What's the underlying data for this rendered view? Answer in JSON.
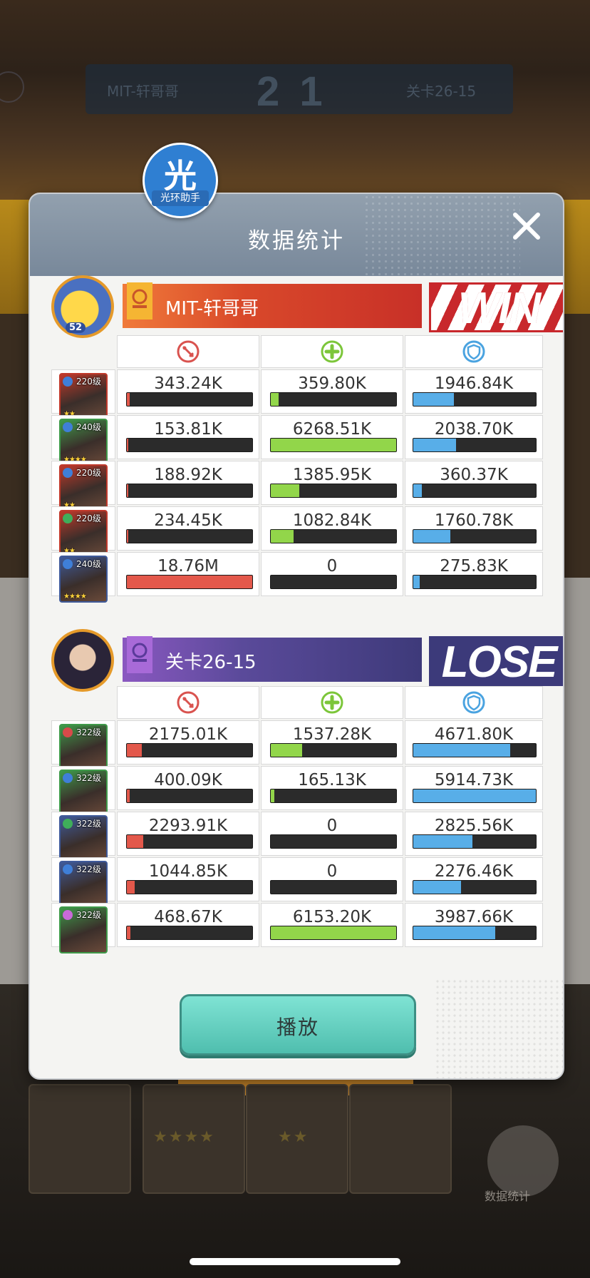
{
  "dialog": {
    "title": "数据统计",
    "helper_badge": {
      "glyph": "光",
      "label": "光环助手"
    },
    "play_button": "播放"
  },
  "background": {
    "score": "2 1",
    "left_name": "MIT-轩哥哥",
    "right_name": "关卡26-15",
    "stats_label": "数据统计"
  },
  "stat_columns": [
    {
      "key": "damage",
      "icon": "damage-icon",
      "color": "#e3584b"
    },
    {
      "key": "healing",
      "icon": "heal-icon",
      "color": "#92d64a"
    },
    {
      "key": "damage_taken",
      "icon": "shield-icon",
      "color": "#58aee8"
    }
  ],
  "teams": [
    {
      "name": "MIT-轩哥哥",
      "result": "WIN",
      "avatar_level": "52",
      "banner_color": "#d9492a",
      "heroes": [
        {
          "level": "220级",
          "gem": "#3f7fd8",
          "stars": "★★",
          "frame": "#c0392b",
          "damage": "343.24K",
          "healing": "359.80K",
          "damage_taken": "1946.84K",
          "damage_pct": 0.02,
          "healing_pct": 0.06,
          "damage_taken_pct": 0.33
        },
        {
          "level": "240级",
          "gem": "#3f7fd8",
          "stars": "★★★★",
          "frame": "#3f9a4a",
          "damage": "153.81K",
          "healing": "6268.51K",
          "damage_taken": "2038.70K",
          "damage_pct": 0.01,
          "healing_pct": 1.0,
          "damage_taken_pct": 0.35
        },
        {
          "level": "220级",
          "gem": "#3f7fd8",
          "stars": "★★",
          "frame": "#c0392b",
          "damage": "188.92K",
          "healing": "1385.95K",
          "damage_taken": "360.37K",
          "damage_pct": 0.01,
          "healing_pct": 0.23,
          "damage_taken_pct": 0.07
        },
        {
          "level": "220级",
          "gem": "#3fae5a",
          "stars": "★★",
          "frame": "#c0392b",
          "damage": "234.45K",
          "healing": "1082.84K",
          "damage_taken": "1760.78K",
          "damage_pct": 0.01,
          "healing_pct": 0.18,
          "damage_taken_pct": 0.3
        },
        {
          "level": "240级",
          "gem": "#3f7fd8",
          "stars": "★★★★",
          "frame": "#3f5a9a",
          "damage": "18.76M",
          "healing": "0",
          "damage_taken": "275.83K",
          "damage_pct": 1.0,
          "healing_pct": 0.0,
          "damage_taken_pct": 0.05
        }
      ]
    },
    {
      "name": "关卡26-15",
      "result": "LOSE",
      "avatar_level": "",
      "banner_color": "#5a4a9a",
      "heroes": [
        {
          "level": "322级",
          "gem": "#d84a4a",
          "stars": "",
          "frame": "#3f9a4a",
          "damage": "2175.01K",
          "healing": "1537.28K",
          "damage_taken": "4671.80K",
          "damage_pct": 0.12,
          "healing_pct": 0.25,
          "damage_taken_pct": 0.79
        },
        {
          "level": "322级",
          "gem": "#3f7fd8",
          "stars": "",
          "frame": "#3f9a4a",
          "damage": "400.09K",
          "healing": "165.13K",
          "damage_taken": "5914.73K",
          "damage_pct": 0.02,
          "healing_pct": 0.03,
          "damage_taken_pct": 1.0
        },
        {
          "level": "322级",
          "gem": "#3fae5a",
          "stars": "",
          "frame": "#3f5a9a",
          "damage": "2293.91K",
          "healing": "0",
          "damage_taken": "2825.56K",
          "damage_pct": 0.13,
          "healing_pct": 0.0,
          "damage_taken_pct": 0.48
        },
        {
          "level": "322级",
          "gem": "#3f7fd8",
          "stars": "",
          "frame": "#3f5a9a",
          "damage": "1044.85K",
          "healing": "0",
          "damage_taken": "2276.46K",
          "damage_pct": 0.06,
          "healing_pct": 0.0,
          "damage_taken_pct": 0.39
        },
        {
          "level": "322级",
          "gem": "#c86ad8",
          "stars": "",
          "frame": "#3f9a4a",
          "damage": "468.67K",
          "healing": "6153.20K",
          "damage_taken": "3987.66K",
          "damage_pct": 0.03,
          "healing_pct": 1.0,
          "damage_taken_pct": 0.67
        }
      ]
    }
  ]
}
